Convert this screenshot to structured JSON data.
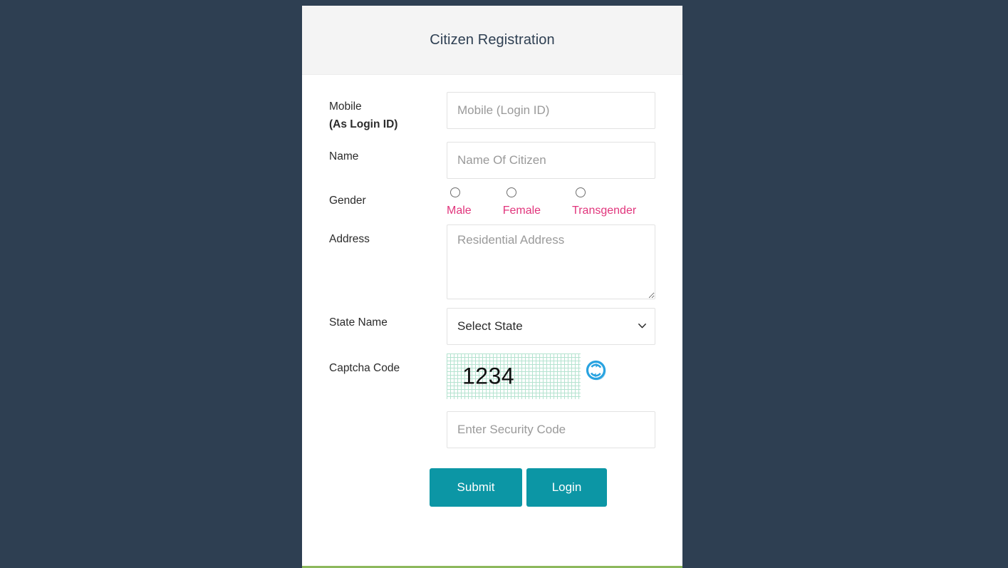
{
  "page": {
    "background_color": "#2e3f52",
    "accent_color": "#0c96a5",
    "radio_label_color": "#e1357c",
    "card_bottom_accent_color": "#8cb85c"
  },
  "card": {
    "title": "Citizen Registration"
  },
  "form": {
    "mobile": {
      "label": "Mobile",
      "label_bold": "(As Login ID)",
      "placeholder": "Mobile (Login ID)",
      "value": ""
    },
    "name": {
      "label": "Name",
      "placeholder": "Name Of Citizen",
      "value": ""
    },
    "gender": {
      "label": "Gender",
      "options": [
        {
          "label": "Male",
          "selected": false
        },
        {
          "label": "Female",
          "selected": false
        },
        {
          "label": "Transgender",
          "selected": false
        }
      ]
    },
    "address": {
      "label": "Address",
      "placeholder": "Residential Address",
      "value": ""
    },
    "state": {
      "label": "State Name",
      "selected": "Select State",
      "options": [
        "Select State"
      ]
    },
    "captcha": {
      "label": "Captcha Code",
      "code": "1234",
      "refresh_icon": "refresh-icon",
      "input_placeholder": "Enter Security Code",
      "input_value": ""
    }
  },
  "actions": {
    "submit_label": "Submit",
    "login_label": "Login"
  }
}
